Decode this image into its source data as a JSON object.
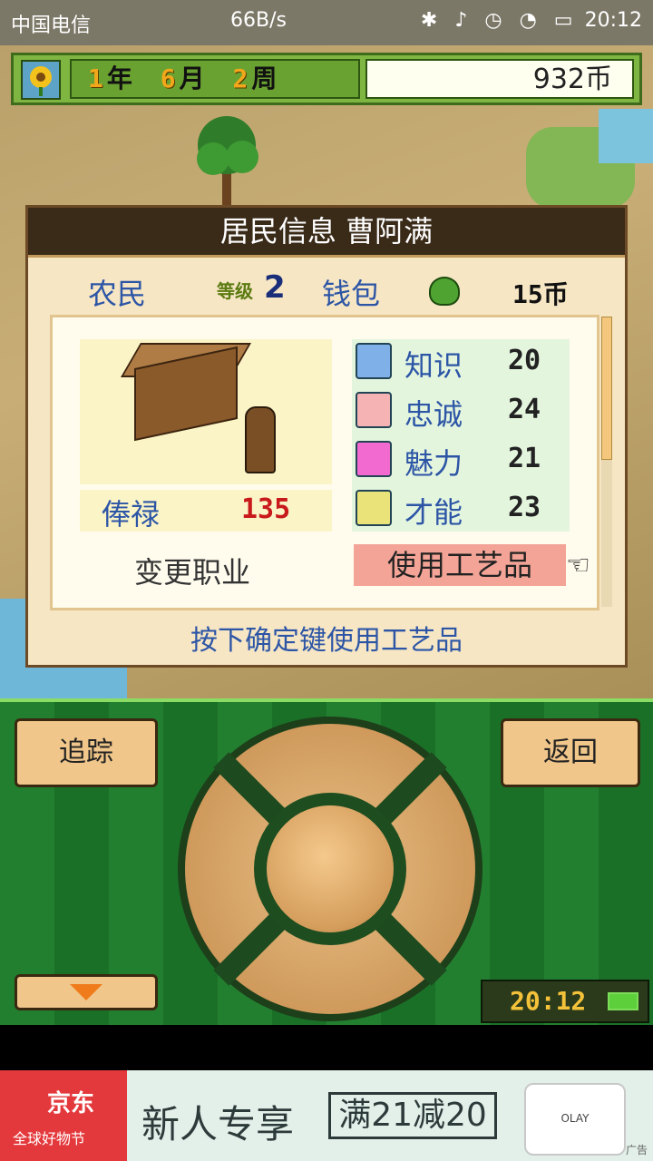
{
  "status_bar": {
    "carrier": "中国电信",
    "speed": "66B/s",
    "time": "20:12"
  },
  "top_bar": {
    "year": "1",
    "year_unit": "年",
    "month": "6",
    "month_unit": "月",
    "week": "2",
    "week_unit": "周",
    "coins": "932币"
  },
  "dialog": {
    "title": "居民信息 曹阿满",
    "job": "农民",
    "level_label": "等级",
    "level": "2",
    "wallet_label": "钱包",
    "wallet_value": "15币",
    "salary_label": "俸禄",
    "salary_value": "135",
    "stats": [
      {
        "label": "知识",
        "value": "20",
        "icon": "lightbulb-icon",
        "color": "#7fb0e8"
      },
      {
        "label": "忠诚",
        "value": "24",
        "icon": "eye-icon",
        "color": "#f5b3b3"
      },
      {
        "label": "魅力",
        "value": "21",
        "icon": "heart-icon",
        "color": "#f26ad0"
      },
      {
        "label": "才能",
        "value": "23",
        "icon": "sparkle-icon",
        "color": "#e9e37a"
      }
    ],
    "change_job": "变更职业",
    "use_item": "使用工艺品",
    "hint": "按下确定键使用工艺品"
  },
  "controls": {
    "track": "追踪",
    "back": "返回",
    "clock": "20:12"
  },
  "ad": {
    "brand": "京东",
    "brand_sub": "全球好物节",
    "slogan": "新人专享",
    "offer": "满21减20",
    "product": "OLAY",
    "tag": "广告"
  }
}
